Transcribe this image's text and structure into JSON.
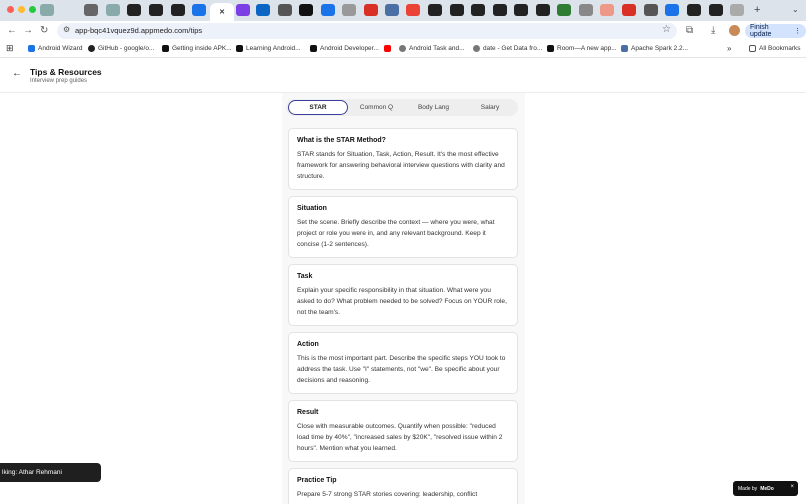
{
  "browser": {
    "url": "app-bqc41vquez9d.appmedo.com/tips",
    "finish_update_label": "Finish update",
    "bookmarks": [
      {
        "label": "Android Wizard",
        "icon": "android-icon"
      },
      {
        "label": "GitHub - google/o...",
        "icon": "github-icon"
      },
      {
        "label": "Getting inside APK...",
        "icon": "medium-icon"
      },
      {
        "label": "Learning Android...",
        "icon": "medium-icon"
      },
      {
        "label": "Android Developer...",
        "icon": "medium-icon"
      },
      {
        "label": "",
        "icon": "youtube-icon"
      },
      {
        "label": "Android Task and...",
        "icon": "globe-icon"
      },
      {
        "label": "date - Get Data fro...",
        "icon": "globe-icon"
      },
      {
        "label": "Room—A new app...",
        "icon": "medium-icon"
      },
      {
        "label": "Apache Spark 2.2...",
        "icon": "spark-icon"
      }
    ],
    "all_bookmarks_label": "All Bookmarks"
  },
  "header": {
    "title": "Tips & Resources",
    "subtitle": "Interview prep guides"
  },
  "tabs": [
    {
      "label": "STAR",
      "active": true
    },
    {
      "label": "Common Q",
      "active": false
    },
    {
      "label": "Body Lang",
      "active": false
    },
    {
      "label": "Salary",
      "active": false
    }
  ],
  "cards": [
    {
      "title": "What is the STAR Method?",
      "body": "STAR stands for Situation, Task, Action, Result. It's the most effective framework for answering behavioral interview questions with clarity and structure."
    },
    {
      "title": "Situation",
      "body": "Set the scene. Briefly describe the context — where you were, what project or role you were in, and any relevant background. Keep it concise (1-2 sentences)."
    },
    {
      "title": "Task",
      "body": "Explain your specific responsibility in that situation. What were you asked to do? What problem needed to be solved? Focus on YOUR role, not the team's."
    },
    {
      "title": "Action",
      "body": "This is the most important part. Describe the specific steps YOU took to address the task. Use \"I\" statements, not \"we\". Be specific about your decisions and reasoning."
    },
    {
      "title": "Result",
      "body": "Close with measurable outcomes. Quantify when possible: \"reduced load time by 40%\", \"increased sales by $20K\", \"resolved issue within 2 hours\". Mention what you learned."
    },
    {
      "title": "Practice Tip",
      "body": "Prepare 5-7 strong STAR stories covering: leadership, conflict"
    }
  ],
  "toast": {
    "text": "lking: Athar Rehmani"
  },
  "badge": {
    "made_by": "Made by",
    "brand": "MeDo",
    "close": "×"
  }
}
